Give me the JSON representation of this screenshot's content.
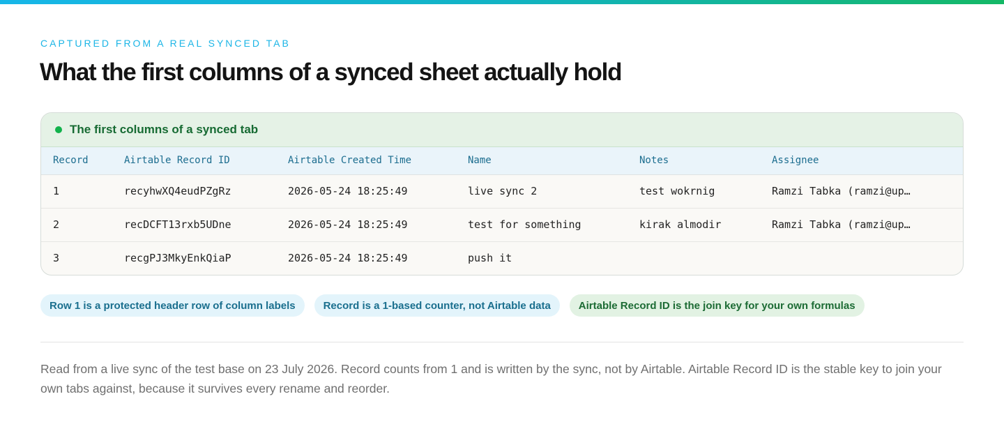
{
  "header": {
    "eyebrow": "CAPTURED FROM A REAL SYNCED TAB",
    "title": "What the first columns of a synced sheet actually hold"
  },
  "card": {
    "title": "The first columns of a synced tab",
    "columns": [
      "Record",
      "Airtable Record ID",
      "Airtable Created Time",
      "Name",
      "Notes",
      "Assignee"
    ],
    "rows": [
      [
        "1",
        "recyhwXQ4eudPZgRz",
        "2026-05-24 18:25:49",
        "live sync 2",
        "test wokrnig",
        "Ramzi Tabka (ramzi@up…"
      ],
      [
        "2",
        "recDCFT13rxb5UDne",
        "2026-05-24 18:25:49",
        "test for something",
        "kirak almodir",
        "Ramzi Tabka (ramzi@up…"
      ],
      [
        "3",
        "recgPJ3MkyEnkQiaP",
        "2026-05-24 18:25:49",
        "push it",
        "",
        ""
      ]
    ]
  },
  "chips": [
    {
      "label": "Row 1 is a protected header row of column labels",
      "tone": "blue"
    },
    {
      "label": "Record is a 1-based counter, not Airtable data",
      "tone": "blue"
    },
    {
      "label": "Airtable Record ID is the join key for your own formulas",
      "tone": "green"
    }
  ],
  "footnote": "Read from a live sync of the test base on 23 July 2026. Record counts from 1 and is written by the sync, not by Airtable. Airtable Record ID is the stable key to join your own tabs against, because it survives every rename and reorder.",
  "colors": {
    "accent_blue": "#1bb5e6",
    "accent_green": "#12b24c"
  }
}
